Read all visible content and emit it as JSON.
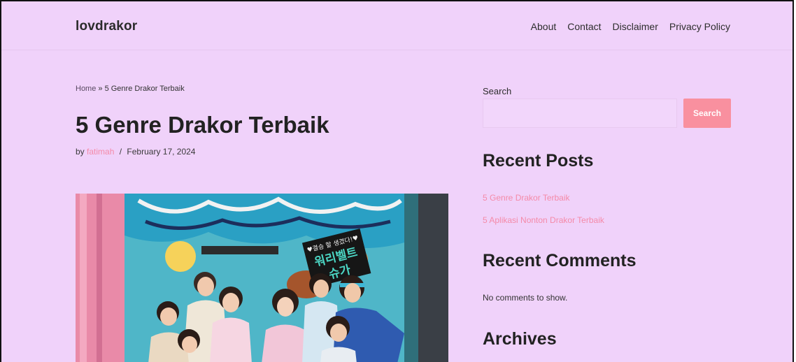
{
  "site": {
    "name": "lovdrakor"
  },
  "nav": {
    "items": [
      "About",
      "Contact",
      "Disclaimer",
      "Privacy Policy"
    ]
  },
  "breadcrumb": {
    "home": "Home",
    "separator": " » ",
    "current": "5 Genre Drakor Terbaik"
  },
  "post": {
    "title": "5 Genre Drakor Terbaik",
    "by": "by",
    "author": "fatimah",
    "separator": "/",
    "date": "February 17, 2024",
    "featured_image": {
      "sign_line1": "♥결승 할 생겼다!♥",
      "sign_line2": "워리벨트",
      "sign_line3": "슈가"
    }
  },
  "sidebar": {
    "search_label": "Search",
    "search_value": "",
    "search_button": "Search",
    "recent_posts_title": "Recent Posts",
    "recent_posts": [
      "5 Genre Drakor Terbaik",
      "5 Aplikasi Nonton Drakor Terbaik"
    ],
    "recent_comments_title": "Recent Comments",
    "no_comments": "No comments to show.",
    "archives_title": "Archives"
  },
  "colors": {
    "background": "#f0d2fa",
    "accent": "#f9909f",
    "link": "#f48aa8",
    "text": "#222222"
  }
}
